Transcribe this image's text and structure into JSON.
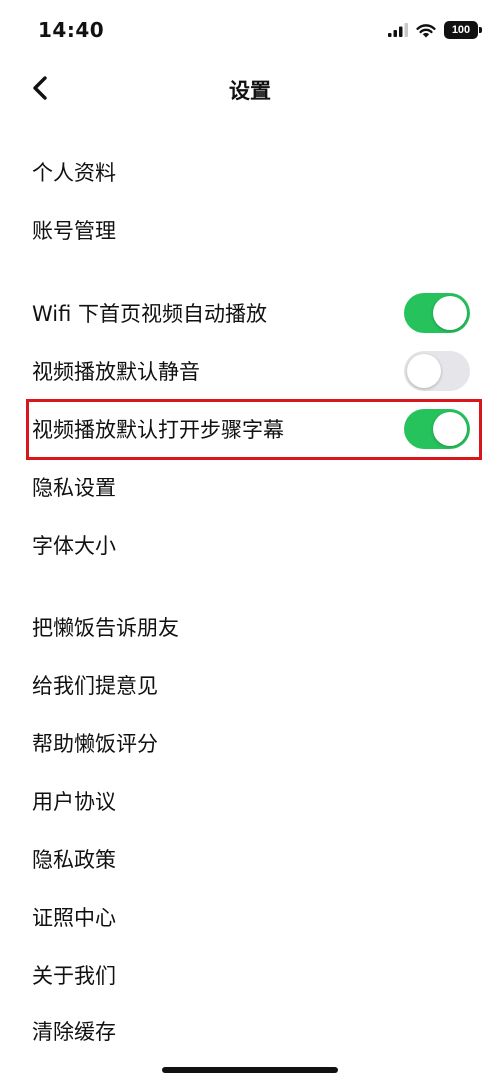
{
  "status_bar": {
    "time": "14:40",
    "battery": "100"
  },
  "nav": {
    "title": "设置"
  },
  "groups": {
    "account": [
      "个人资料",
      "账号管理"
    ],
    "video": [
      {
        "label": "Wifi 下首页视频自动播放",
        "on": true
      },
      {
        "label": "视频播放默认静音",
        "on": false
      },
      {
        "label": "视频播放默认打开步骤字幕",
        "on": true
      }
    ],
    "display": [
      "隐私设置",
      "字体大小"
    ],
    "about": [
      "把懒饭告诉朋友",
      "给我们提意见",
      "帮助懒饭评分",
      "用户协议",
      "隐私政策",
      "证照中心",
      "关于我们",
      "清除缓存"
    ]
  },
  "colors": {
    "toggle_on": "#26c25c",
    "toggle_off": "#e6e6ea",
    "highlight": "#d9161c"
  }
}
